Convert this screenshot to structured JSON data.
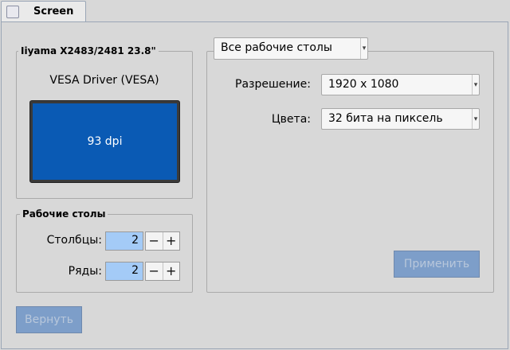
{
  "tab": {
    "label": "Screen",
    "icon": "window-icon"
  },
  "monitor": {
    "name": "Iiyama X2483/2481 23.8\"",
    "driver": "VESA Driver (VESA)",
    "dpi_label": "93 dpi",
    "screen_color": "#0a5ab4"
  },
  "desktops": {
    "title": "Рабочие столы",
    "columns_label": "Столбцы:",
    "columns_value": "2",
    "rows_label": "Ряды:",
    "rows_value": "2",
    "minus": "−",
    "plus": "+"
  },
  "revert_label": "Вернуть",
  "settings": {
    "workspace_selector": "Все рабочие столы",
    "resolution_label": "Разрешение:",
    "resolution_value": "1920 x 1080",
    "colors_label": "Цвета:",
    "colors_value": "32 бита на пиксель",
    "apply_label": "Применить"
  },
  "colors": {
    "background": "#d8d8d8",
    "field_highlight": "#a4cbf7",
    "disabled_button": "#7d9ec9"
  }
}
